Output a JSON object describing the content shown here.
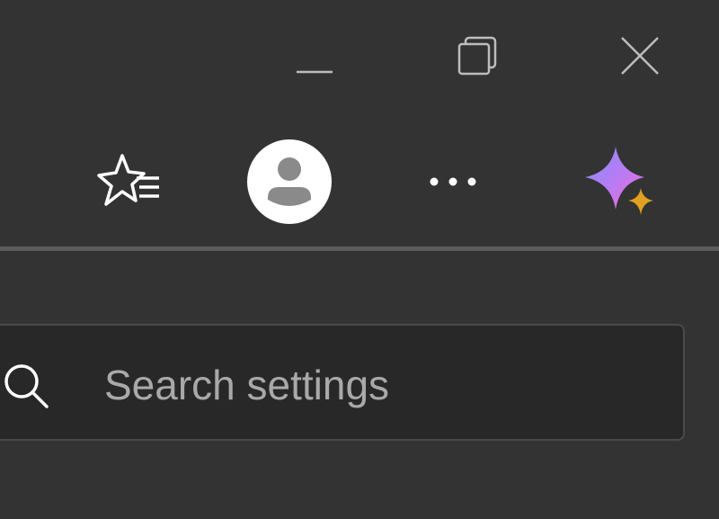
{
  "window_controls": {
    "minimize_icon": "minimize-icon",
    "maximize_icon": "restore-icon",
    "close_icon": "close-icon"
  },
  "toolbar": {
    "favorites_icon": "favorites-star-list-icon",
    "profile_icon": "profile-avatar-icon",
    "more_icon": "more-ellipsis-icon",
    "copilot_icon": "copilot-sparkle-icon"
  },
  "search": {
    "placeholder": "Search settings",
    "value": ""
  },
  "colors": {
    "background": "#333333",
    "search_background": "#282828",
    "divider": "#5b5b5b",
    "icon_stroke": "#ffffff",
    "placeholder_text": "#a9a9a9",
    "copilot_gradient_start": "#9a7cf6",
    "copilot_gradient_end": "#f06bd8",
    "copilot_accent": "#e0a020"
  }
}
